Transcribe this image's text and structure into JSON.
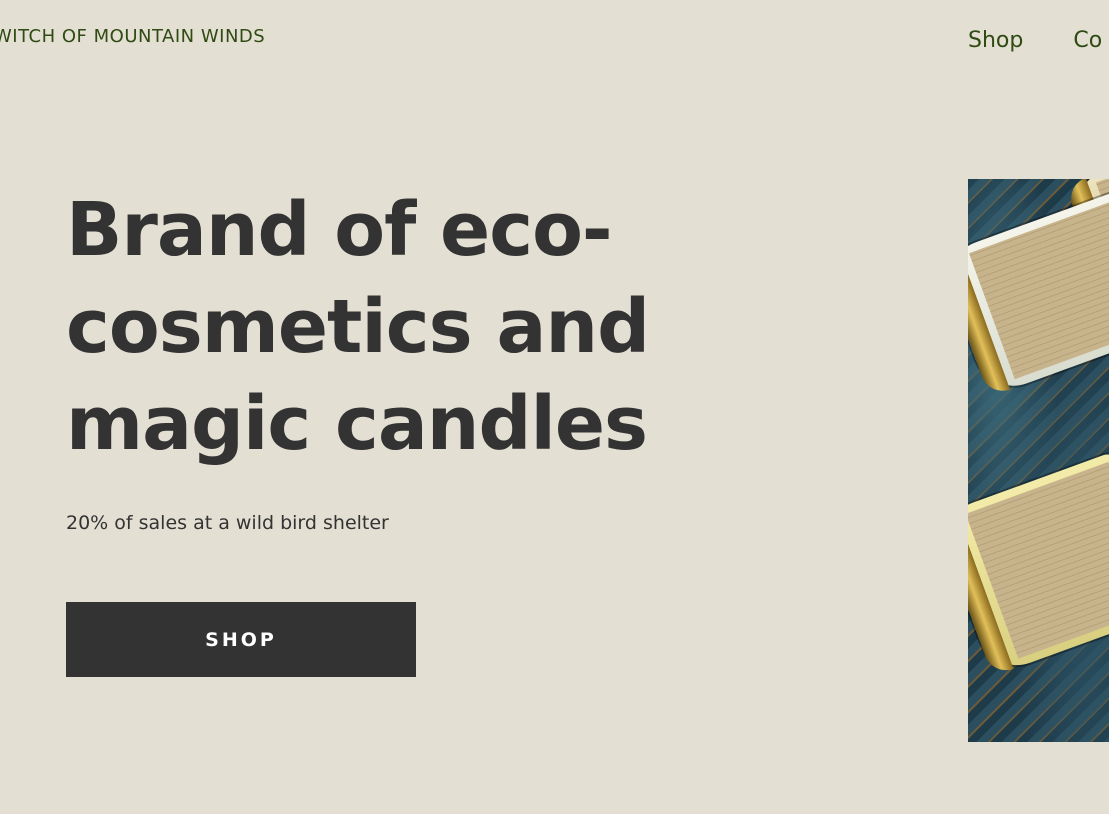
{
  "header": {
    "brand": "WITCH OF MOUNTAIN WINDS",
    "nav": [
      "Shop",
      "Co"
    ]
  },
  "hero": {
    "title": "Brand of eco-cosmetics and magic candles",
    "subtitle": "20% of sales at a wild bird shelter",
    "cta_label": "SHOP"
  },
  "colors": {
    "background": "#e3dfd2",
    "text_dark": "#333333",
    "nav_green": "#2f4a12",
    "button_bg": "#333333",
    "button_text": "#ffffff"
  }
}
